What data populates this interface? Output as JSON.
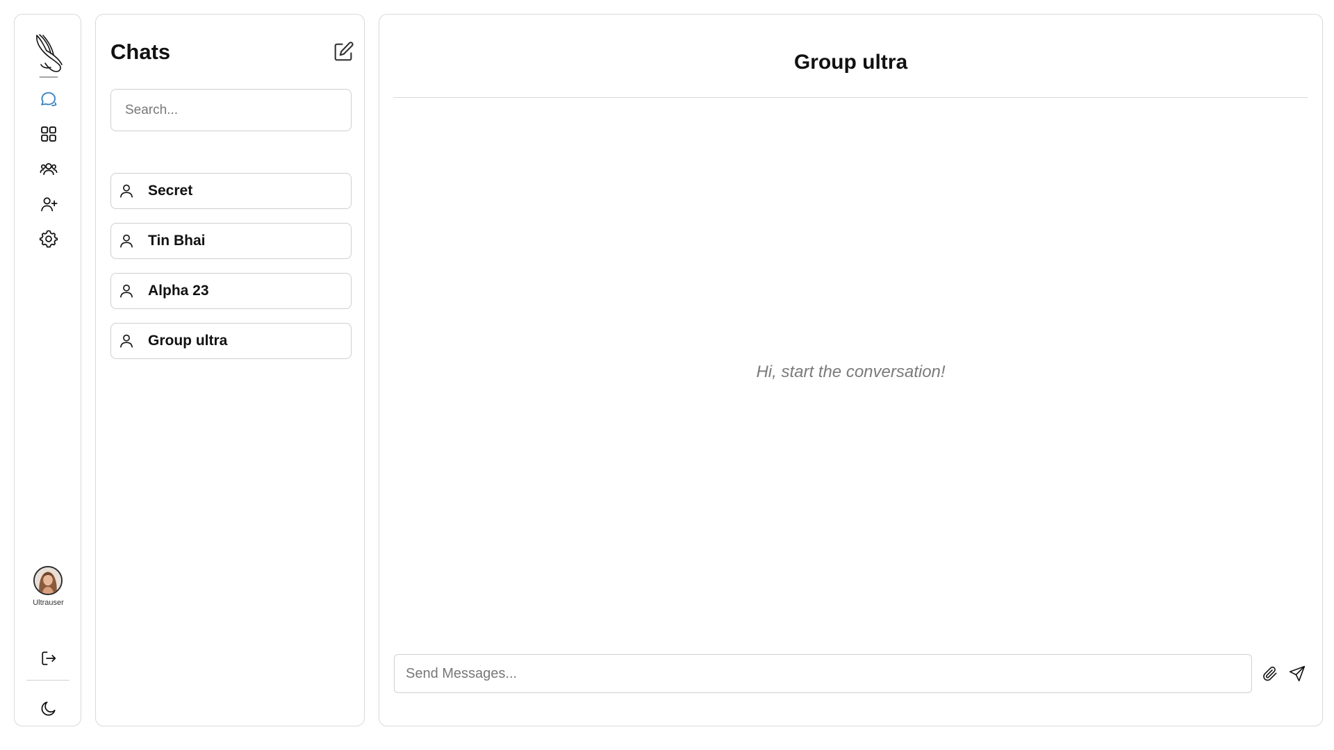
{
  "rail": {
    "items": [
      {
        "name": "chats",
        "icon": "chat-bubbles-icon",
        "active": true
      },
      {
        "name": "apps",
        "icon": "grid-icon",
        "active": false
      },
      {
        "name": "groups",
        "icon": "users-icon",
        "active": false
      },
      {
        "name": "add-friend",
        "icon": "user-plus-icon",
        "active": false
      },
      {
        "name": "settings",
        "icon": "gear-icon",
        "active": false
      }
    ],
    "username": "Ultrauser",
    "bottom_icons": [
      "logout-icon",
      "moon-icon"
    ]
  },
  "chats": {
    "title": "Chats",
    "compose_icon": "edit-icon",
    "search_placeholder": "Search...",
    "list": [
      {
        "name": "Secret",
        "icon": "user-icon"
      },
      {
        "name": "Tin Bhai",
        "icon": "user-icon"
      },
      {
        "name": "Alpha 23",
        "icon": "user-icon"
      },
      {
        "name": "Group ultra",
        "icon": "user-icon"
      }
    ]
  },
  "conversation": {
    "title": "Group ultra",
    "empty_message": "Hi, start the conversation!",
    "input_placeholder": "Send Messages...",
    "attach_icon": "paperclip-icon",
    "send_icon": "send-icon"
  },
  "colors": {
    "accent": "#3b82c4",
    "border": "#d9d9d9",
    "text": "#111111",
    "muted": "#7a7a7a"
  }
}
